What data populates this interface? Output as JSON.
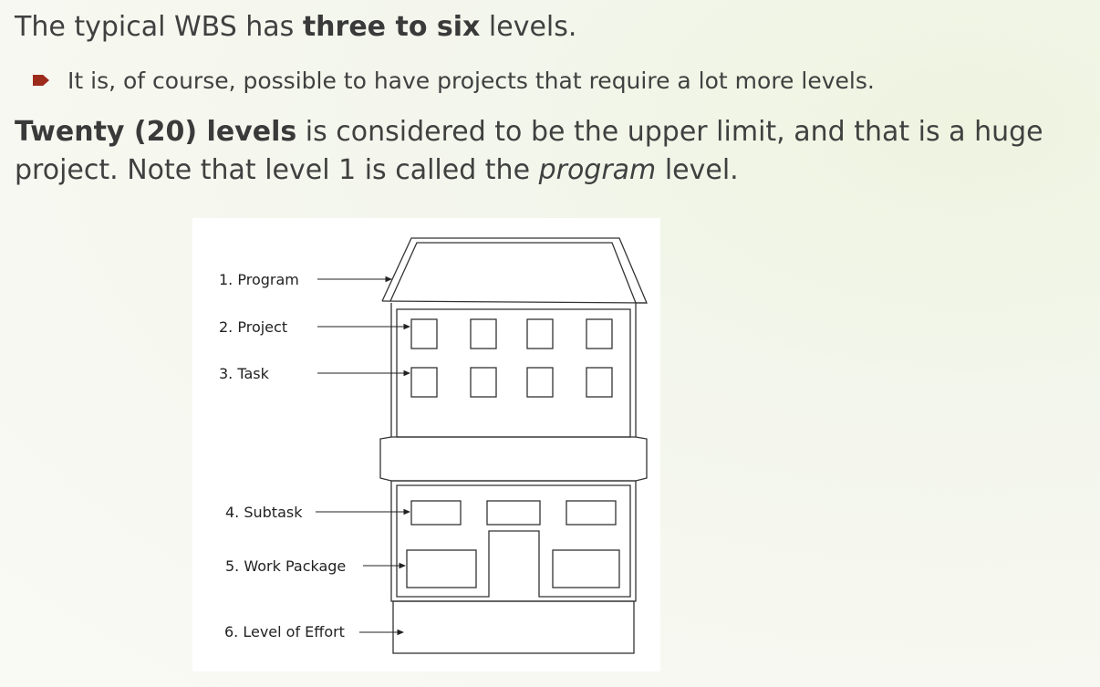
{
  "heading": {
    "prefix": "The typical WBS has ",
    "bold": "three to six",
    "suffix": " levels."
  },
  "bullet": {
    "text": "It is, of course, possible to have projects that require a lot more levels."
  },
  "paragraph": {
    "bold": "Twenty (20) levels",
    "text1": " is considered to be the upper limit, and that is a huge project. Note that level 1 is called the ",
    "italic": "program",
    "text2": " level."
  },
  "figure": {
    "levels": [
      "1. Program",
      "2. Project",
      "3. Task",
      "4. Subtask",
      "5. Work Package",
      "6. Level of Effort"
    ]
  },
  "colors": {
    "bullet_marker": "#9c2b1c",
    "text": "#404040"
  }
}
